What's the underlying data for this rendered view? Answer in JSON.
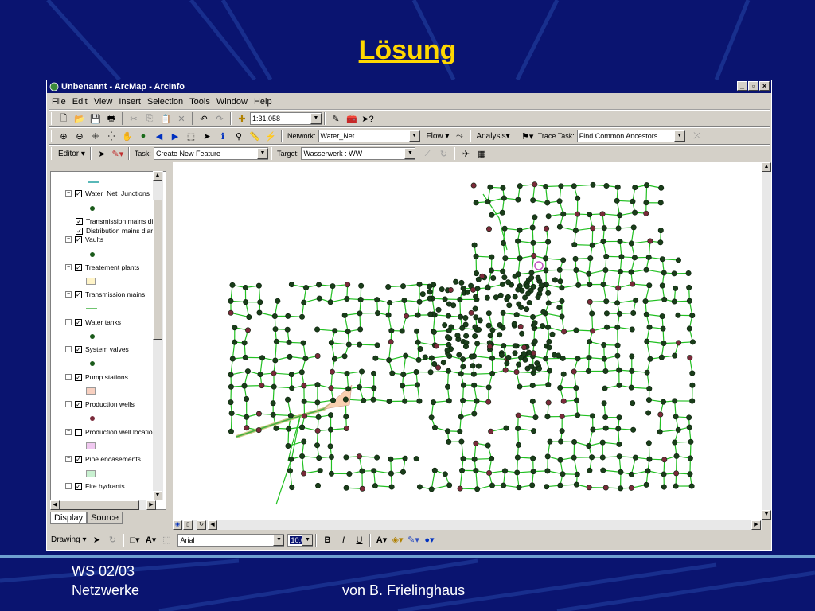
{
  "slide": {
    "title": "Lösung",
    "footer_left_1": "WS 02/03",
    "footer_left_2": "Netzwerke",
    "footer_right": "von B. Frielinghaus"
  },
  "window": {
    "title": "Unbenannt - ArcMap - ArcInfo",
    "buttons": [
      "_",
      "▫",
      "×"
    ]
  },
  "menu": [
    "File",
    "Edit",
    "View",
    "Insert",
    "Selection",
    "Tools",
    "Window",
    "Help"
  ],
  "standard_toolbar": {
    "scale": "1:31.058"
  },
  "network_toolbar": {
    "network_label": "Network:",
    "network_value": "Water_Net",
    "flow_label": "Flow ▾",
    "analysis_label": "Analysis▾",
    "trace_task_label": "Trace Task:",
    "trace_task_value": "Find Common Ancestors"
  },
  "editor_toolbar": {
    "editor_label": "Editor ▾",
    "task_label": "Task:",
    "task_value": "Create New Feature",
    "target_label": "Target:",
    "target_value": "Wasserwerk : WW"
  },
  "toc": {
    "layers": [
      {
        "label": "Water_Net_Junctions",
        "checked": true,
        "expand": "⊟"
      },
      {
        "label": "Transmission mains di",
        "checked": true,
        "expand": ""
      },
      {
        "label": "Distribution mains diar",
        "checked": true,
        "expand": ""
      },
      {
        "label": "Vaults",
        "checked": true,
        "expand": "⊟"
      },
      {
        "label": "Treatement plants",
        "checked": true,
        "expand": "⊟"
      },
      {
        "label": "Transmission mains",
        "checked": true,
        "expand": "⊟"
      },
      {
        "label": "Water tanks",
        "checked": true,
        "expand": "⊟"
      },
      {
        "label": "System valves",
        "checked": true,
        "expand": "⊟"
      },
      {
        "label": "Pump stations",
        "checked": true,
        "expand": "⊟"
      },
      {
        "label": "Production wells",
        "checked": true,
        "expand": "⊟"
      },
      {
        "label": "Production well locatio",
        "checked": false,
        "expand": "⊟"
      },
      {
        "label": "Pipe encasements",
        "checked": true,
        "expand": "⊟"
      },
      {
        "label": "Fire hydrants",
        "checked": true,
        "expand": "⊟"
      }
    ],
    "tabs": [
      "Display",
      "Source"
    ]
  },
  "drawing_toolbar": {
    "drawing_label": "Drawing ▾",
    "font_value": "Arial",
    "font_size": "10,0"
  },
  "colors": {
    "slide_bg": "#0a1470",
    "title": "#ffd700",
    "pipe": "#22c022",
    "junction": "#1a3d1a"
  }
}
